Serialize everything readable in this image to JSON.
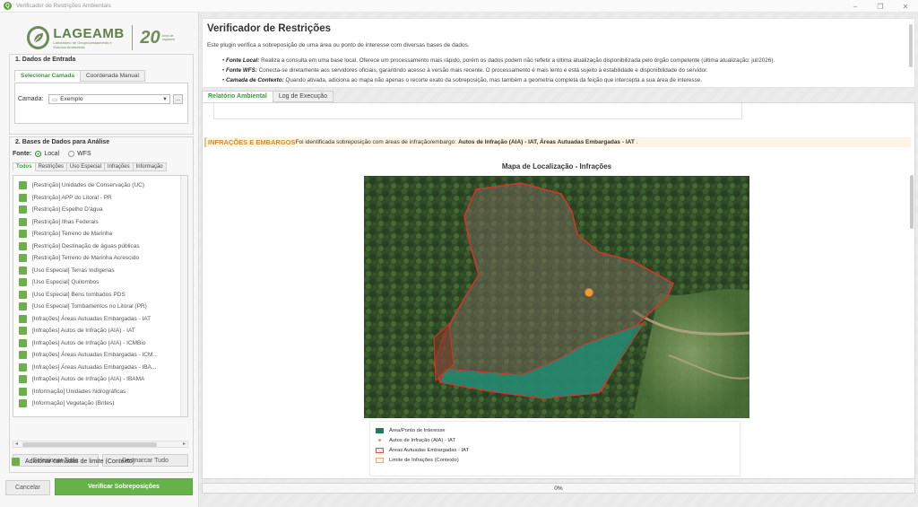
{
  "window": {
    "title": "Verificador de Restrições Ambientais",
    "controls": [
      "–",
      "❐",
      "✕"
    ]
  },
  "brand": {
    "logo_name": "LAGEAMB",
    "logo_sub": "Laboratório de Geoprocessamento e Estudos Ambientais",
    "anniversary": "20",
    "anniversary_sub": "Anos de Lageamb"
  },
  "input_section": {
    "title": "1. Dados de Entrada",
    "tabs": [
      "Selecionar Camada",
      "Coordenada Manual"
    ],
    "active_tab": "Selecionar Camada",
    "layer_label": "Camada:",
    "layer_value": "Exemplo",
    "browse_label": "..."
  },
  "databases_section": {
    "title": "2. Bases de Dados para Análise",
    "source_label": "Fonte:",
    "source_options": [
      "Local",
      "WFS"
    ],
    "source_selected": "Local",
    "filter_tabs": [
      "Todos",
      "Restrições",
      "Uso Especial",
      "Infrações",
      "Informação"
    ],
    "active_filter": "Todos",
    "layers": [
      "[Restrição] Unidades de Conservação (UC)",
      "[Restrição] APP do Litoral - PR",
      "[Restrição] Espelho D'água",
      "[Restrição] Ilhas Federais",
      "[Restrição] Terreno de Marinha",
      "[Restrição] Destinação de águas públicas",
      "[Restrição] Terreno de Marinha Acrescido",
      "[Uso Especial] Terras Indígenas",
      "[Uso Especial] Quilombos",
      "[Uso Especial] Bens tombados PDS",
      "[Uso Especial] Tombamentos no Litoral (PR)",
      "[Infrações] Áreas Autuadas Embargadas - IAT",
      "[Infrações] Autos de Infração (AIA) - IAT",
      "[Infrações] Autos de Infração (AIA) - ICMBio",
      "[Infrações] Áreas Autuadas Embargadas - ICM...",
      "[Infrações] Áreas Autuadas Embargadas - IBA...",
      "[Infrações] Autos de Infração (AIA) - IBAMA",
      "[Informação] Unidades hidrográficas",
      "[Informação] Vegetação (Brites)"
    ],
    "select_all": "Selecionar Tudo",
    "deselect_all": "Desmarcar Tudo",
    "limit_layers": "Adicionar camadas de limite (Contexto)"
  },
  "footer_buttons": {
    "cancel": "Cancelar",
    "verify": "Verificar Sobreposições"
  },
  "header": {
    "title": "Verificador de Restrições",
    "description": "Este plugin verifica a sobreposição de uma área ou ponto de interesse com diversas bases de dados.",
    "bullets": [
      {
        "label": "Fonte Local:",
        "text": "Realiza a consulta em uma base local. Oferece um processamento mais rápido, porém os dados podem não refletir a última atualização disponibilizada pelo órgão competente (última atualização: jul/2026)."
      },
      {
        "label": "Fonte WFS:",
        "text": "Conecta-se diretamente aos servidores oficiais, garantindo acesso à versão mais recente. O processamento é mais lento e está sujeito à estabilidade e disponibilidade do servidor."
      },
      {
        "label": "Camada de Contexto:",
        "text": "Quando ativada, adiciona ao mapa não apenas o recorte exato da sobreposição, mas também a geometria completa da feição que intercepta a sua área de interesse."
      }
    ]
  },
  "report_tabs": [
    "Relatório Ambiental",
    "Log de Execução"
  ],
  "active_report_tab": "Relatório Ambiental",
  "report": {
    "alert_title": "INFRAÇÕES E EMBARGOS",
    "alert_text": "Foi identificada sobreposição com áreas de infração/embargo:",
    "alert_layers": "Autos de Infração (AIA) - IAT, Áreas Autuadas Embargadas - IAT",
    "alert_end": ".",
    "map_title": "Mapa de Localização - Infrações",
    "legend": [
      {
        "label": "Área/Ponto de Interesse",
        "kind": "fill",
        "color": "#1f7a64"
      },
      {
        "label": "Autos de Infração (AIA) - IAT",
        "kind": "dot",
        "color": "#f09a3a"
      },
      {
        "label": "Áreas Autuadas Embargadas - IAT",
        "kind": "hatch",
        "color": "#d9534f"
      },
      {
        "label": "Limite de Infrações (Contexto)",
        "kind": "outline",
        "color": "#e6a97a"
      }
    ]
  },
  "progress": {
    "value": 0,
    "label": "0%"
  },
  "colors": {
    "accent_green": "#66b24a",
    "alert_orange": "#d08a2c",
    "embargo_red": "#d9342a"
  }
}
